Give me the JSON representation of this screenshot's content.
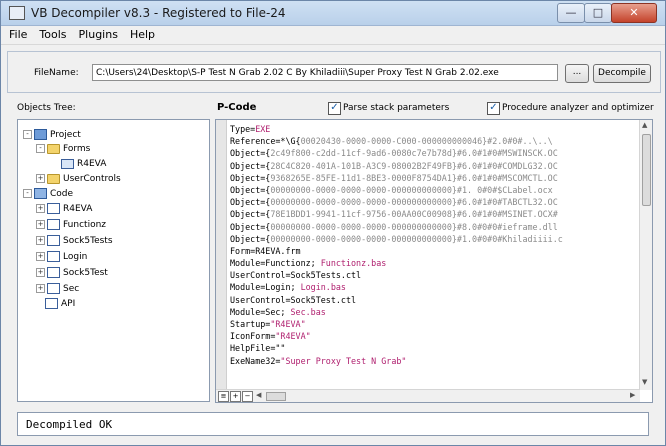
{
  "window": {
    "title": "VB Decompiler v8.3 - Registered to File-24"
  },
  "menu": [
    "File",
    "Tools",
    "Plugins",
    "Help"
  ],
  "file": {
    "label": "FileName:",
    "path": "C:\\Users\\24\\Desktop\\S-P Test N Grab 2.02 C By Khiladiii\\Super Proxy Test N Grab 2.02.exe",
    "browse_label": "...",
    "decompile_label": "Decompile"
  },
  "tree": {
    "header": "Objects Tree:",
    "nodes": [
      {
        "label": "Project",
        "icon": "project-icon",
        "expander": "-"
      },
      {
        "label": "Forms",
        "icon": "folder-icon",
        "expander": "-"
      },
      {
        "label": "R4EVA",
        "icon": "form-icon",
        "expander": ""
      },
      {
        "label": "UserControls",
        "icon": "folder-icon",
        "expander": "+"
      },
      {
        "label": "Code",
        "icon": "code-icon",
        "expander": "-"
      },
      {
        "label": "R4EVA",
        "icon": "module-icon",
        "expander": "+"
      },
      {
        "label": "Functionz",
        "icon": "module-icon",
        "expander": "+"
      },
      {
        "label": "Sock5Tests",
        "icon": "module-icon",
        "expander": "+"
      },
      {
        "label": "Login",
        "icon": "module-icon",
        "expander": "+"
      },
      {
        "label": "Sock5Test",
        "icon": "module-icon",
        "expander": "+"
      },
      {
        "label": "Sec",
        "icon": "module-icon",
        "expander": "+"
      },
      {
        "label": "API",
        "icon": "module-icon",
        "expander": ""
      }
    ]
  },
  "pcode": {
    "label": "P-Code",
    "parse_stack_label": "Parse stack parameters",
    "parse_stack_checked": "✓",
    "analyzer_label": "Procedure analyzer and optimizer",
    "analyzer_checked": "✓",
    "lines": [
      {
        "k": "Type=",
        "s": "EXE",
        "g": ""
      },
      {
        "k": "Reference=*\\G{",
        "s": "",
        "g": "00020430-0000-0000-C000-000000000046}#2.0#0#..\\..\\"
      },
      {
        "k": "Object={",
        "s": "",
        "g": "2c49f800-c2dd-11cf-9ad6-0080c7e7b78d}#6.0#1#0#MSWINSCK.OC"
      },
      {
        "k": "Object={",
        "s": "",
        "g": "28C4C820-401A-101B-A3C9-08002B2F49FB}#6.0#1#0#COMDLG32.OC"
      },
      {
        "k": "Object={",
        "s": "",
        "g": "9368265E-85FE-11d1-8BE3-0000F8754DA1}#6.0#1#0#MSCOMCTL.OC"
      },
      {
        "k": "Object={",
        "s": "",
        "g": "00000000-0000-0000-0000-000000000000}#1. 0#0#$CLabel.ocx"
      },
      {
        "k": "Object={",
        "s": "",
        "g": "00000000-0000-0000-0000-000000000000}#6.0#1#0#TABCTL32.OC"
      },
      {
        "k": "Object={",
        "s": "",
        "g": "78E1BDD1-9941-11cf-9756-00AA00C00908}#6.0#1#0#MSINET.OCX#"
      },
      {
        "k": "Object={",
        "s": "",
        "g": "00000000-0000-0000-0000-000000000000}#8.0#0#0#ieframe.dll"
      },
      {
        "k": "Object={",
        "s": "",
        "g": "00000000-0000-0000-0000-000000000000}#1.0#0#0#Khiladiiii.c"
      },
      {
        "k": "Form=R4EVA.frm",
        "s": "",
        "g": ""
      },
      {
        "k": "Module=Functionz; ",
        "s": "Functionz.bas",
        "g": ""
      },
      {
        "k": "UserControl=Sock5Tests.ctl",
        "s": "",
        "g": ""
      },
      {
        "k": "Module=Login; ",
        "s": "Login.bas",
        "g": ""
      },
      {
        "k": "UserControl=Sock5Test.ctl",
        "s": "",
        "g": ""
      },
      {
        "k": "Module=Sec; ",
        "s": "Sec.bas",
        "g": ""
      },
      {
        "k": "Startup=",
        "s": "\"R4EVA\"",
        "g": ""
      },
      {
        "k": "IconForm=",
        "s": "\"R4EVA\"",
        "g": ""
      },
      {
        "k": "HelpFile=\"\"",
        "s": "",
        "g": ""
      },
      {
        "k": "ExeName32=",
        "s": "\"Super Proxy Test N Grab\"",
        "g": ""
      }
    ]
  },
  "status": {
    "text": "Decompiled OK"
  }
}
